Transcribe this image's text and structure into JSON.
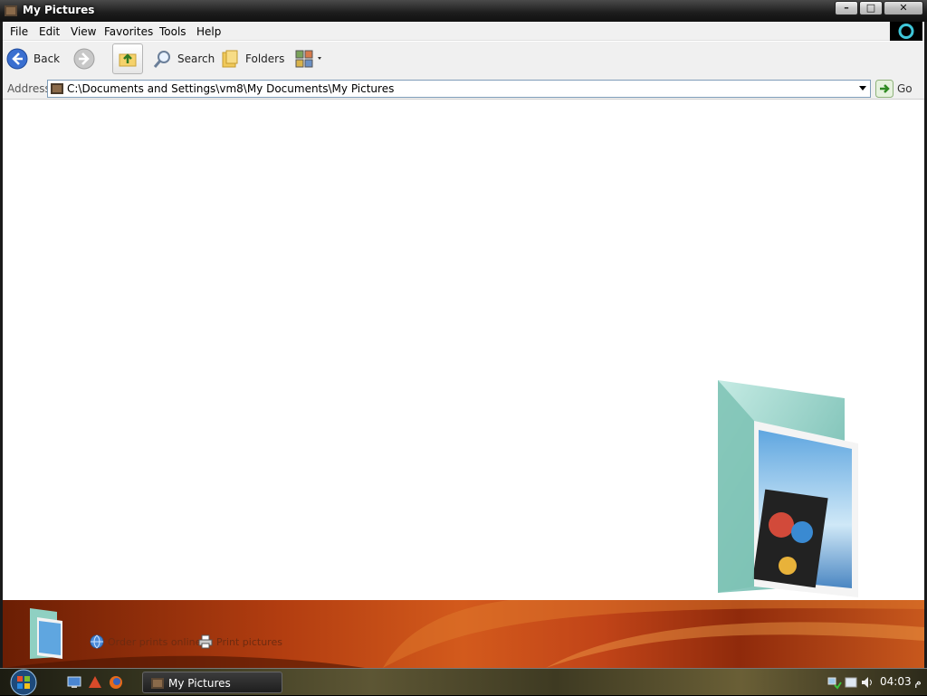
{
  "window": {
    "title": "My Pictures",
    "minimize_glyph": "–",
    "maximize_glyph": "□",
    "close_glyph": "✕"
  },
  "menu": {
    "items": [
      "File",
      "Edit",
      "View",
      "Favorites",
      "Tools",
      "Help"
    ]
  },
  "toolbar": {
    "back_label": "Back",
    "search_label": "Search",
    "folders_label": "Folders"
  },
  "address": {
    "label": "Address",
    "value": "C:\\Documents and Settings\\vm8\\My Documents\\My Pictures",
    "go_label": "Go"
  },
  "tasks": {
    "order_prints": "Order prints online",
    "print_pictures": "Print pictures"
  },
  "taskbar": {
    "window_button": "My Pictures",
    "clock": "04:03 م"
  },
  "icons": [
    "window-app-icon",
    "windows-logo-icon",
    "back-arrow-icon",
    "forward-arrow-icon",
    "up-folder-icon",
    "search-icon",
    "folders-icon",
    "views-icon",
    "address-folder-icon",
    "dropdown-icon",
    "go-arrow-icon",
    "pictures-folder-icon",
    "globe-icon",
    "printer-icon",
    "start-orb-icon",
    "show-desktop-icon",
    "media-icon",
    "firefox-icon",
    "network-icon",
    "security-icon",
    "volume-icon"
  ],
  "colors": {
    "accent_blue": "#3a6fd0",
    "band_orange": "#c14418",
    "link_text": "#6e2b10"
  }
}
